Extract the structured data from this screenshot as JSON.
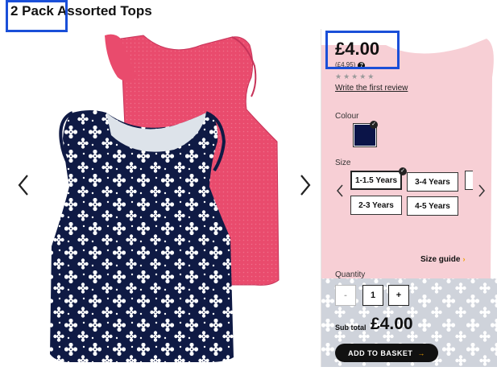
{
  "product": {
    "title": "2 Pack Assorted Tops",
    "price": "£4.00",
    "was_price": "(£4.95)",
    "help_icon": "?",
    "stars": "★★★★★",
    "review_link": "Write the first review"
  },
  "options": {
    "colour_label": "Colour",
    "colour_swatch": "#0b1448",
    "size_label": "Size",
    "sizes": [
      "1-1.5 Years",
      "3-4 Years",
      "2-3 Years",
      "4-5 Years"
    ],
    "selected_size": "1-1.5 Years",
    "size_guide": "Size guide",
    "size_guide_chevron": "›"
  },
  "quantity": {
    "label": "Quantity",
    "minus": "-",
    "value": "1",
    "plus": "+"
  },
  "subtotal": {
    "label": "Sub total",
    "value": "£4.00"
  },
  "cta": {
    "add_to_basket": "ADD TO BASKET",
    "arrow": "→"
  },
  "colors": {
    "highlight": "#1a4fd8",
    "top_pink": "#e94b6d",
    "top_navy": "#0f1a44",
    "panel_pink": "#f6c9d0"
  }
}
